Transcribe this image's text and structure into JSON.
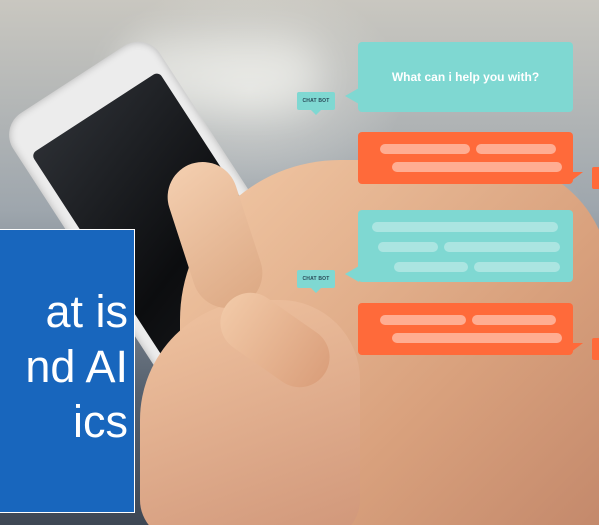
{
  "scene": {
    "title_lines": [
      "at is",
      "nd AI",
      "ics"
    ],
    "chat": {
      "question": "What can i help you with?",
      "bot_tag_1": "CHAT BOT",
      "bot_tag_2": "CHAT BOT"
    },
    "colors": {
      "title_box": "#1866bd",
      "bubble_teal": "#7fd8d2",
      "bubble_coral": "#ff6a3a"
    }
  }
}
